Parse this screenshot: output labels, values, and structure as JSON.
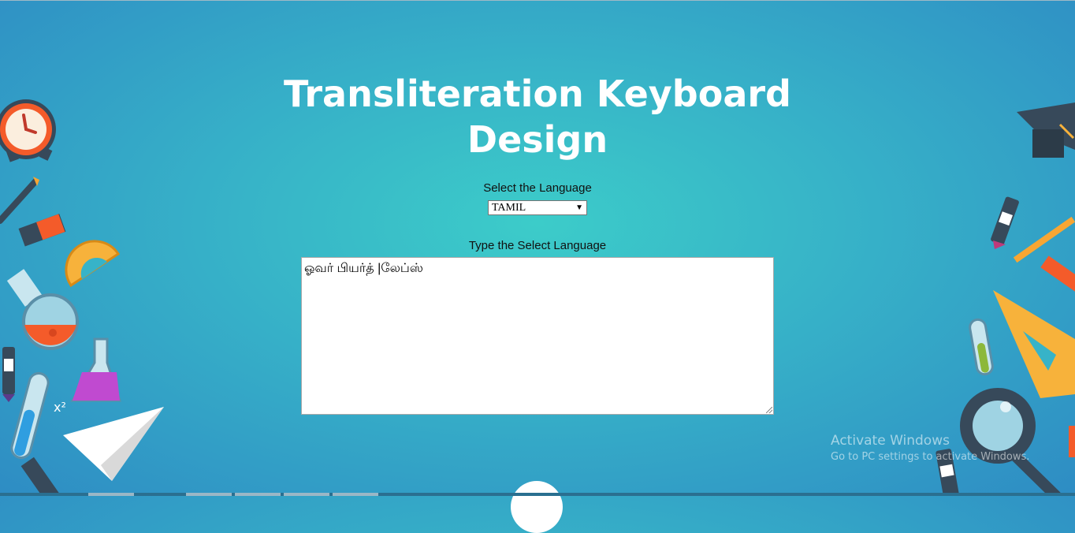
{
  "page": {
    "title": "Transliteration Keyboard Design"
  },
  "form": {
    "select_label": "Select the Language",
    "selected_language": "TAMIL",
    "type_label": "Type the Select Language",
    "text_value": "ஓவர் பியர்த் |லேப்ஸ்"
  },
  "watermark": {
    "line1": "Activate Windows",
    "line2": "Go to PC settings to activate Windows."
  },
  "colors": {
    "bg_center": "#3cccc9",
    "bg_edge": "#2e8cc4",
    "title": "#ffffff"
  }
}
